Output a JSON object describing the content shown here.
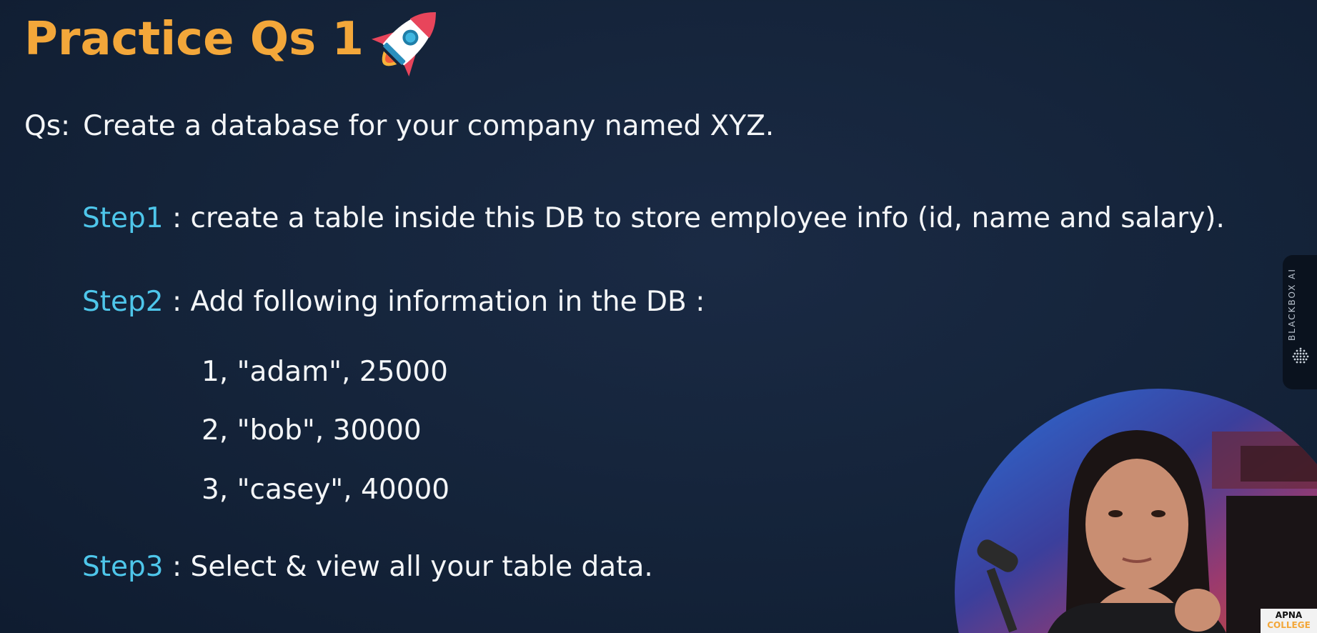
{
  "slide": {
    "title": "Practice Qs 1",
    "question_prefix": "Qs:",
    "question_text": "Create a database for your company named XYZ.",
    "steps": [
      {
        "label": "Step1",
        "text": " : create a table inside this DB to store employee info (id, name and salary)."
      },
      {
        "label": "Step2",
        "text": " : Add following information in the DB :"
      },
      {
        "label": "Step3",
        "text": " : Select & view all your table data."
      }
    ],
    "rows": [
      "1, \"adam\", 25000",
      "2, \"bob\", 30000",
      "3, \"casey\", 40000"
    ]
  },
  "side_tab": {
    "label": "BLACKBOX AI",
    "icon": "blackbox-dots-icon"
  },
  "brand_badge": {
    "line1": "APNA",
    "line2": "COLLEGE"
  },
  "colors": {
    "background": "#142339",
    "title": "#f3a73a",
    "step_label": "#4ec6ea",
    "body_text": "#f4f6f8"
  }
}
